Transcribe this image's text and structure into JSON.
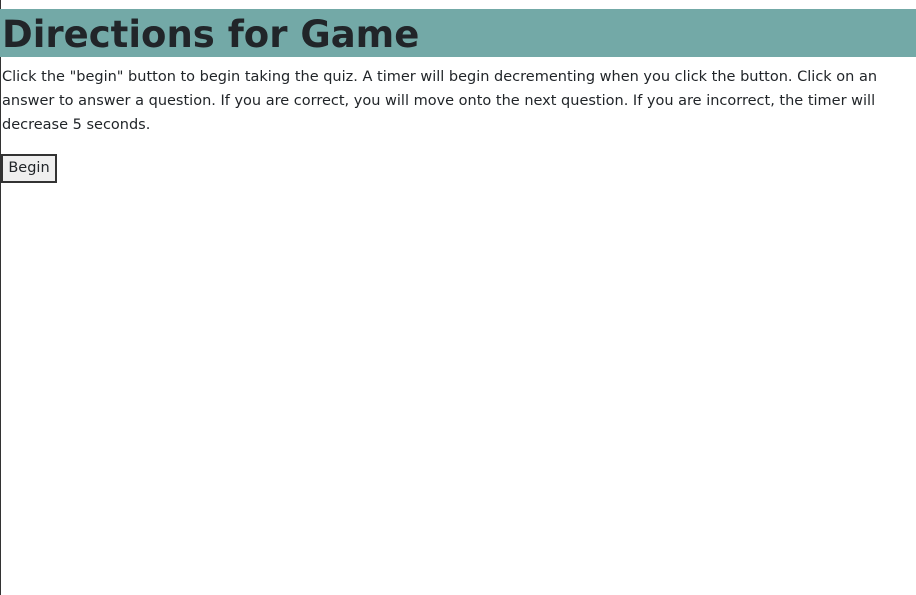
{
  "page": {
    "title": "Directions for Game",
    "directions": "Click the \"begin\" button to begin taking the quiz. A timer will begin decrementing when you click the button. Click on an answer to answer a question. If you are correct, you will move onto the next question. If you are incorrect, the timer will decrease 5 seconds.",
    "begin_label": "Begin"
  },
  "colors": {
    "header_background": "#73a9a7",
    "text": "#212529",
    "button_background": "#efefef",
    "button_border": "#333333"
  }
}
